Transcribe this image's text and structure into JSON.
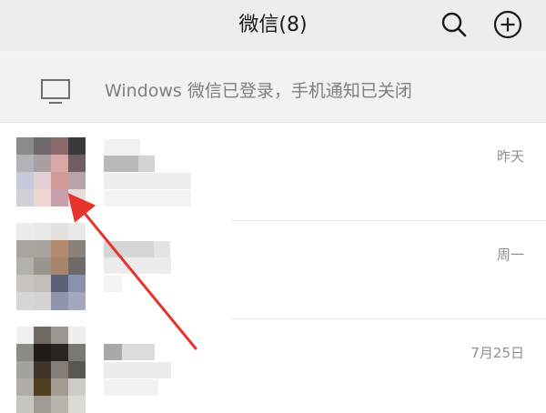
{
  "header": {
    "title": "微信(8)",
    "search_icon": "search-icon",
    "add_icon": "plus-circle-icon",
    "background": "#ededed"
  },
  "notice": {
    "icon": "desktop-monitor-icon",
    "text": "Windows 微信已登录，手机通知已关闭"
  },
  "chats": [
    {
      "time": "昨天",
      "avatar": "pixelated-avatar",
      "name": "",
      "preview": ""
    },
    {
      "time": "周一",
      "avatar": "pixelated-avatar",
      "name": "",
      "preview": ""
    },
    {
      "time": "7月25日",
      "avatar": "pixelated-avatar",
      "name": "",
      "preview": ""
    }
  ],
  "annotation": {
    "type": "red-arrow",
    "color": "#e8322c",
    "points_to": "first chat avatar"
  }
}
